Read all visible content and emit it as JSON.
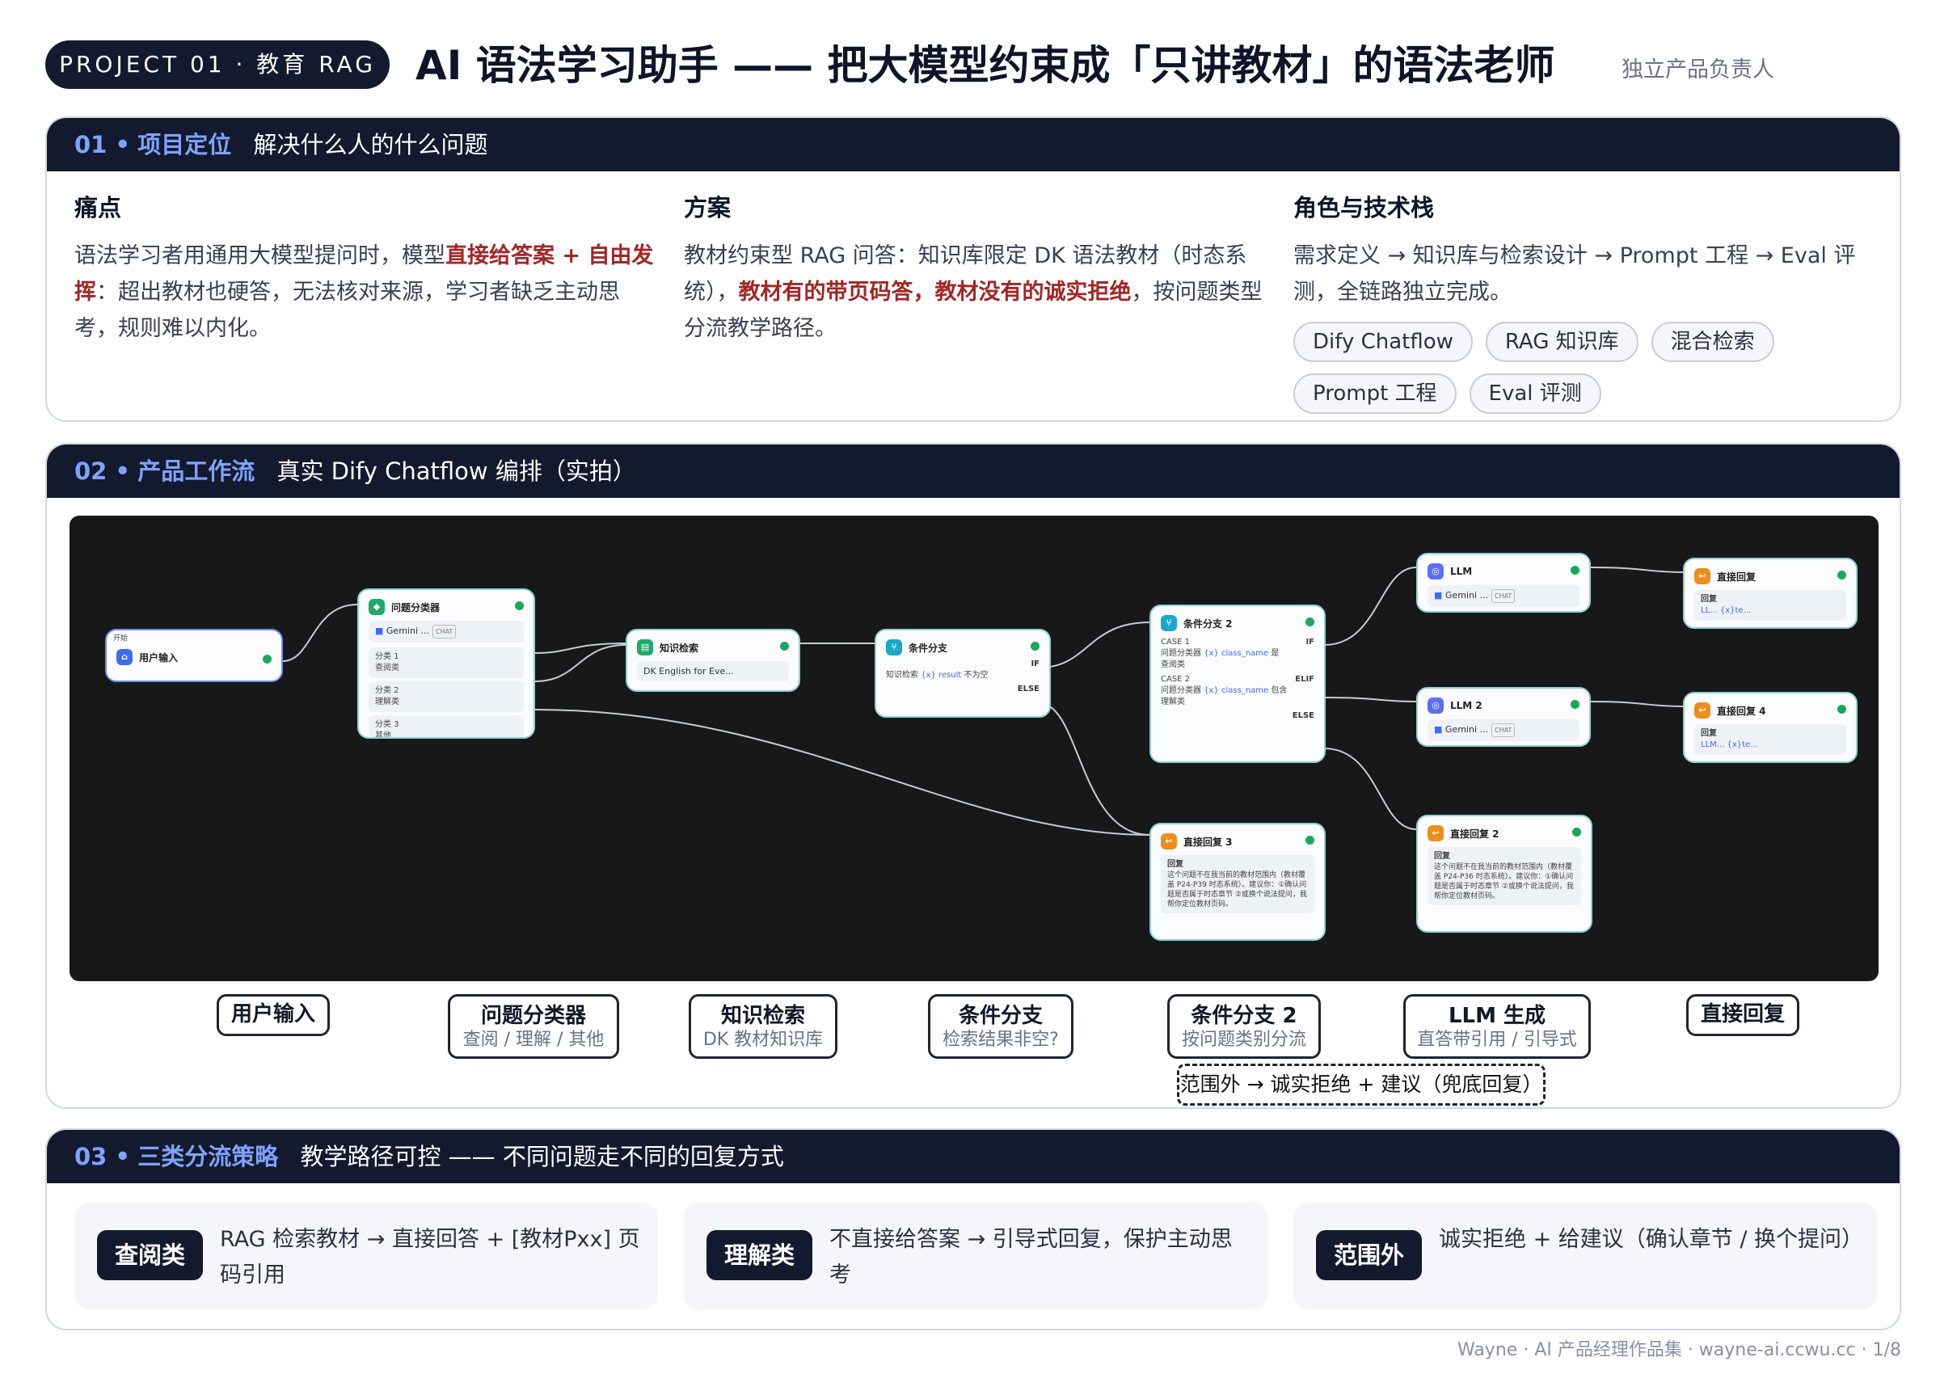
{
  "header": {
    "project_pill": "PROJECT 01 · 教育 RAG",
    "title": "AI 语法学习助手 —— 把大模型约束成「只讲教材」的语法老师",
    "role": "独立产品负责人"
  },
  "section1": {
    "num": "01 •",
    "title": "项目定位",
    "subtitle": "解决什么人的什么问题",
    "pain": {
      "heading": "痛点",
      "text_a": "语法学习者用通用大模型提问时，模型",
      "highlight": "直接给答案 + 自由发挥",
      "text_b": "：超出教材也硬答，无法核对来源，学习者缺乏主动思考，规则难以内化。"
    },
    "solution": {
      "heading": "方案",
      "text_a": "教材约束型 RAG 问答：知识库限定 DK 语法教材（时态系统），",
      "highlight": "教材有的带页码答，教材没有的诚实拒绝",
      "text_b": "，按问题类型分流教学路径。"
    },
    "role": {
      "heading": "角色与技术栈",
      "text": "需求定义 → 知识库与检索设计 → Prompt 工程 → Eval 评测，全链路独立完成。",
      "tags": [
        "Dify Chatflow",
        "RAG 知识库",
        "混合检索",
        "Prompt 工程",
        "Eval 评测"
      ]
    }
  },
  "section2": {
    "num": "02 •",
    "title": "产品工作流",
    "subtitle": "真实 Dify Chatflow 编排（实拍）",
    "nodes": {
      "start": {
        "tab": "开始",
        "title": "用户输入"
      },
      "classifier": {
        "title": "问题分类器",
        "model": "Gemini ...",
        "chat": "CHAT",
        "c1": "分类 1",
        "c1v": "查阅类",
        "c2": "分类 2",
        "c2v": "理解类",
        "c3": "分类 3",
        "c3v": "其他"
      },
      "kb": {
        "title": "知识检索",
        "row": "DK English for Eve..."
      },
      "cond1": {
        "title": "条件分支",
        "if": "IF",
        "row_a": "知识检索",
        "row_var": "{x} result",
        "row_b": "不为空",
        "else": "ELSE"
      },
      "cond2": {
        "title": "条件分支 2",
        "case1": "CASE 1",
        "if": "IF",
        "c1_a": "问题分类器",
        "c1_var": "{x} class_name",
        "c1_op": "是",
        "c1_val": "查阅类",
        "case2": "CASE 2",
        "elif": "ELIF",
        "c2_a": "问题分类器",
        "c2_var": "{x} class_name",
        "c2_op": "包含",
        "c2_val": "理解类",
        "else": "ELSE"
      },
      "llm1": {
        "title": "LLM",
        "model": "Gemini ...",
        "chat": "CHAT"
      },
      "llm2": {
        "title": "LLM 2",
        "model": "Gemini ...",
        "chat": "CHAT"
      },
      "reply1": {
        "title": "直接回复",
        "label": "回复",
        "row": "LL... {x}te..."
      },
      "reply4": {
        "title": "直接回复 4",
        "label": "回复",
        "row": "LLM... {x}te..."
      },
      "reply2": {
        "title": "直接回复 2",
        "label": "回复",
        "text": "这个问题不在我当前的教材范围内（教材覆盖 P24-P36 时态系统）。建议你：①确认问题是否属于时态章节 ②或换个说法提问，我帮你定位教材页码。"
      },
      "reply3": {
        "title": "直接回复 3",
        "label": "回复",
        "text": "这个问题不在我当前的教材范围内（教材覆盖 P24-P39 时态系统）。建议你：①确认问题是否属于时态章节 ②或换个说法提问，我帮你定位教材页码。"
      }
    },
    "labels": [
      {
        "name": "用户输入",
        "sub": ""
      },
      {
        "name": "问题分类器",
        "sub": "查阅 / 理解 / 其他"
      },
      {
        "name": "知识检索",
        "sub": "DK 教材知识库"
      },
      {
        "name": "条件分支",
        "sub": "检索结果非空?"
      },
      {
        "name": "条件分支 2",
        "sub": "按问题类别分流"
      },
      {
        "name": "LLM 生成",
        "sub": "直答带引用 / 引导式"
      },
      {
        "name": "直接回复",
        "sub": ""
      }
    ],
    "fallback": "范围外 → 诚实拒绝 + 建议（兜底回复）"
  },
  "section3": {
    "num": "03 •",
    "title": "三类分流策略",
    "subtitle": "教学路径可控 —— 不同问题走不同的回复方式",
    "items": [
      {
        "chip": "查阅类",
        "text": "RAG 检索教材 → 直接回答 + [教材Pxx] 页码引用"
      },
      {
        "chip": "理解类",
        "text": "不直接给答案 → 引导式回复，保护主动思考"
      },
      {
        "chip": "范围外",
        "text": "诚实拒绝 + 给建议（确认章节 / 换个提问）"
      }
    ]
  },
  "footer": "Wayne · AI 产品经理作品集 · wayne-ai.ccwu.cc · 1/8"
}
